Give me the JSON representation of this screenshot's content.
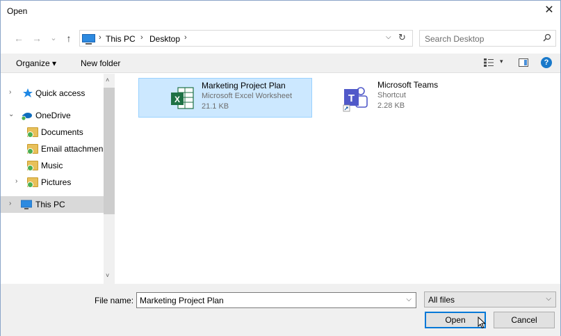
{
  "window": {
    "title": "Open",
    "close_glyph": "✕"
  },
  "address": {
    "back_glyph": "←",
    "forward_glyph": "→",
    "recent_glyph": "⌄",
    "up_glyph": "↑",
    "crumbs": [
      "This PC",
      "Desktop"
    ],
    "separator": "›",
    "dropdown_glyph": "⌵",
    "refresh_glyph": "↻",
    "search_placeholder": "Search Desktop",
    "icons": [
      "arrow-left-icon",
      "arrow-right-icon",
      "chevron-down-icon",
      "arrow-up-icon",
      "this-pc-icon",
      "refresh-icon",
      "search-icon"
    ]
  },
  "toolbar": {
    "organize_label": "Organize ▾",
    "new_folder_label": "New folder",
    "view_dropdown_glyph": "▾",
    "help_glyph": "?",
    "icons": [
      "view-options-icon",
      "preview-pane-icon",
      "help-icon"
    ]
  },
  "nav": {
    "items": [
      {
        "label": "Quick access",
        "chevron": "›",
        "icon": "star-icon"
      },
      {
        "label": "OneDrive",
        "chevron": "⌄",
        "icon": "onedrive-icon"
      },
      {
        "label": "Documents",
        "chevron": "",
        "icon": "folder-icon"
      },
      {
        "label": "Email attachmen",
        "chevron": "",
        "icon": "folder-icon"
      },
      {
        "label": "Music",
        "chevron": "",
        "icon": "folder-icon"
      },
      {
        "label": "Pictures",
        "chevron": "›",
        "icon": "folder-icon"
      },
      {
        "label": "This PC",
        "chevron": "›",
        "icon": "this-pc-icon"
      }
    ],
    "scroll_up_glyph": "˄",
    "scroll_down_glyph": "˅"
  },
  "files": [
    {
      "name": "Marketing Project Plan",
      "type": "Microsoft Excel Worksheet",
      "size": "21.1 KB",
      "icon": "excel-icon",
      "selected": true
    },
    {
      "name": "Microsoft Teams",
      "type": "Shortcut",
      "size": "2.28 KB",
      "icon": "teams-icon",
      "selected": false
    }
  ],
  "footer": {
    "filename_label": "File name:",
    "filename_value": "Marketing Project Plan",
    "dropdown_glyph": "⌵",
    "filter_value": "All files",
    "open_label": "Open",
    "cancel_label": "Cancel"
  },
  "colors": {
    "accent": "#0078d7",
    "selection": "#cce8ff",
    "excel": "#1e7145",
    "teams": "#5059c9"
  }
}
